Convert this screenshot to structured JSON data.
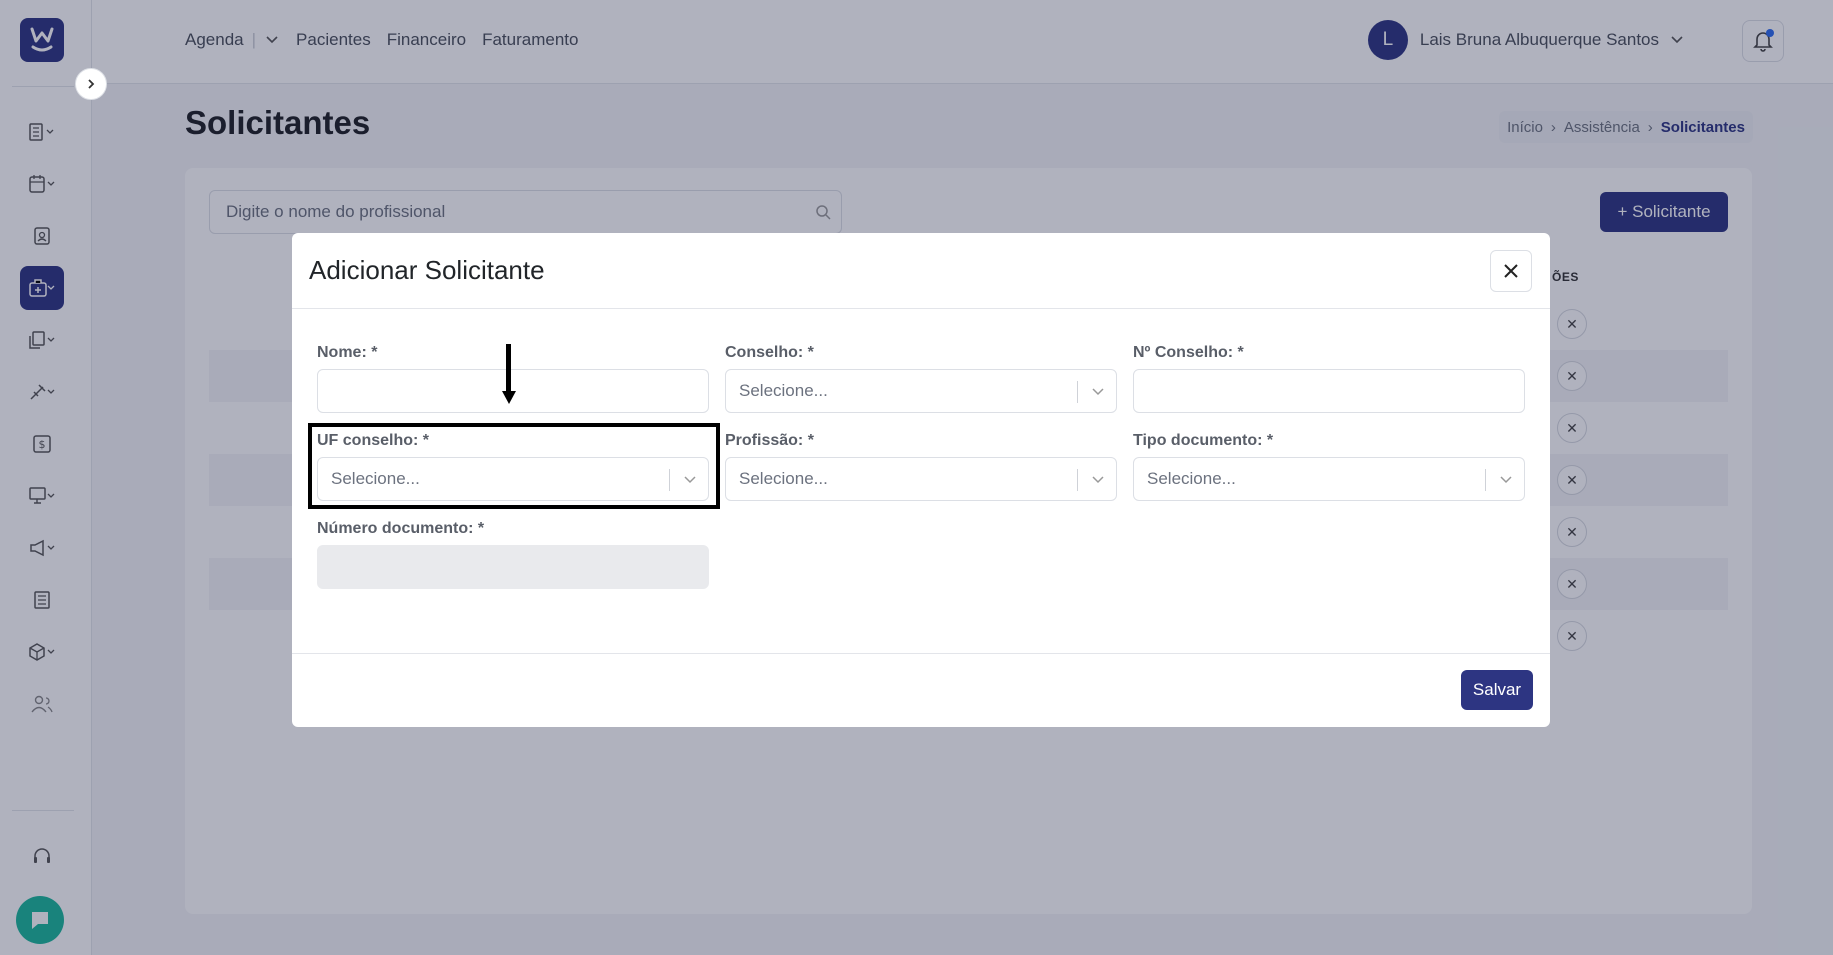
{
  "nav": {
    "items": [
      "Agenda",
      "Pacientes",
      "Financeiro",
      "Faturamento"
    ]
  },
  "user": {
    "initial": "L",
    "name": "Lais Bruna Albuquerque Santos"
  },
  "page": {
    "title": "Solicitantes",
    "breadcrumb": [
      "Início",
      "Assistência",
      "Solicitantes"
    ]
  },
  "list": {
    "search_placeholder": "Digite o nome do profissional",
    "add_button": "+ Solicitante",
    "column_actions": "ÕES",
    "delete_glyph": "✕"
  },
  "modal": {
    "title": "Adicionar Solicitante",
    "save_button": "Salvar",
    "fields": {
      "nome": {
        "label": "Nome: *",
        "value": ""
      },
      "conselho": {
        "label": "Conselho: *",
        "placeholder": "Selecione..."
      },
      "numero_conselho": {
        "label": "Nº Conselho: *",
        "value": ""
      },
      "uf_conselho": {
        "label": "UF conselho: *",
        "placeholder": "Selecione..."
      },
      "profissao": {
        "label": "Profissão: *",
        "placeholder": "Selecione..."
      },
      "tipo_documento": {
        "label": "Tipo documento: *",
        "placeholder": "Selecione..."
      },
      "numero_documento": {
        "label": "Número documento: *",
        "value": ""
      }
    }
  },
  "colors": {
    "brand": "#2d3582",
    "chat": "#1bb89c",
    "notification_dot": "#2d6cf0"
  }
}
